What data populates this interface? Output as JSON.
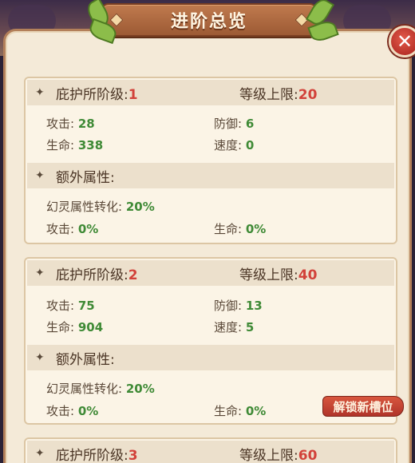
{
  "header": {
    "title": "进阶总览"
  },
  "close_symbol": "✕",
  "diamond_symbol": "✦",
  "labels": {
    "rank": "庇护所阶级:",
    "level_cap": "等级上限:",
    "extra": "额外属性:",
    "attack": "攻击:",
    "defense": "防御:",
    "hp": "生命:",
    "speed": "速度:",
    "phantom": "幻灵属性转化:",
    "extra_attack": "攻击:",
    "extra_hp": "生命:"
  },
  "tiers": [
    {
      "rank": "1",
      "level_cap": "20",
      "attack": "28",
      "defense": "6",
      "hp": "338",
      "speed": "0",
      "phantom": "20%",
      "extra_attack": "0%",
      "extra_hp": "0%"
    },
    {
      "rank": "2",
      "level_cap": "40",
      "attack": "75",
      "defense": "13",
      "hp": "904",
      "speed": "5",
      "phantom": "20%",
      "extra_attack": "0%",
      "extra_hp": "0%"
    },
    {
      "rank": "3",
      "level_cap": "60"
    }
  ],
  "unlock_button": "解锁新槽位",
  "colors": {
    "accent_red": "#d2423a",
    "value_green": "#3f8a36",
    "banner_brown": "#9c5a34",
    "panel_bg": "#f4ead8"
  }
}
